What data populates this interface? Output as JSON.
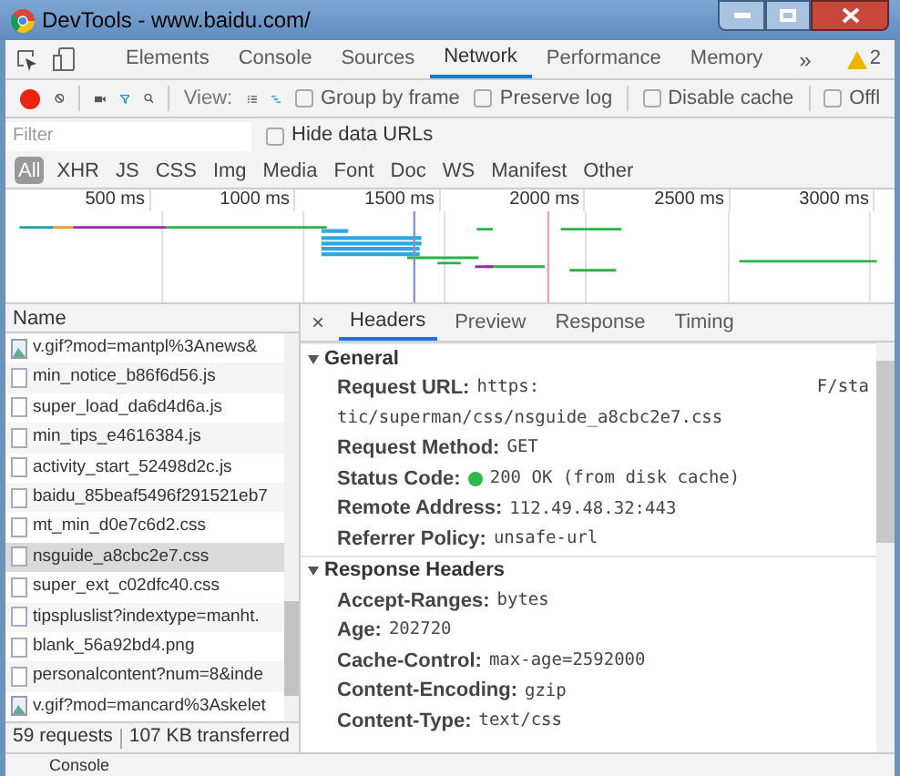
{
  "window": {
    "title": "DevTools - www.baidu.com/"
  },
  "panel_tabs": [
    {
      "label": "Elements",
      "selected": false
    },
    {
      "label": "Console",
      "selected": false
    },
    {
      "label": "Sources",
      "selected": false
    },
    {
      "label": "Network",
      "selected": true
    },
    {
      "label": "Performance",
      "selected": false
    },
    {
      "label": "Memory",
      "selected": false
    }
  ],
  "more_tabs": "»",
  "warnings": "2",
  "toolbar": {
    "recording": true,
    "view_label": "View:",
    "checkboxes": [
      {
        "label": "Group by frame",
        "checked": false
      },
      {
        "label": "Preserve log",
        "checked": false
      },
      {
        "label": "Disable cache",
        "checked": false
      },
      {
        "label": "Offl",
        "checked": false
      }
    ]
  },
  "filter": {
    "placeholder": "Filter",
    "hide_data_urls": {
      "label": "Hide data URLs",
      "checked": false
    }
  },
  "types": [
    {
      "label": "All",
      "selected": true
    },
    {
      "label": "XHR",
      "selected": false
    },
    {
      "label": "JS",
      "selected": false
    },
    {
      "label": "CSS",
      "selected": false
    },
    {
      "label": "Img",
      "selected": false
    },
    {
      "label": "Media",
      "selected": false
    },
    {
      "label": "Font",
      "selected": false
    },
    {
      "label": "Doc",
      "selected": false
    },
    {
      "label": "WS",
      "selected": false
    },
    {
      "label": "Manifest",
      "selected": false
    },
    {
      "label": "Other",
      "selected": false
    }
  ],
  "timeline": {
    "ticks": [
      "500 ms",
      "1000 ms",
      "1500 ms",
      "2000 ms",
      "2500 ms",
      "3000 ms"
    ]
  },
  "requests": {
    "column": "Name",
    "rows": [
      {
        "name": "v.gif?mod=mantpl%3Anews&",
        "kind": "image",
        "selected": false
      },
      {
        "name": "min_notice_b86f6d56.js",
        "kind": "file",
        "selected": false
      },
      {
        "name": "super_load_da6d4d6a.js",
        "kind": "file",
        "selected": false
      },
      {
        "name": "min_tips_e4616384.js",
        "kind": "file",
        "selected": false
      },
      {
        "name": "activity_start_52498d2c.js",
        "kind": "file",
        "selected": false
      },
      {
        "name": "baidu_85beaf5496f291521eb7",
        "kind": "file",
        "selected": false
      },
      {
        "name": "mt_min_d0e7c6d2.css",
        "kind": "file",
        "selected": false
      },
      {
        "name": "nsguide_a8cbc2e7.css",
        "kind": "file",
        "selected": true
      },
      {
        "name": "super_ext_c02dfc40.css",
        "kind": "file",
        "selected": false
      },
      {
        "name": "tipspluslist?indextype=manht.",
        "kind": "file",
        "selected": false
      },
      {
        "name": "blank_56a92bd4.png",
        "kind": "file",
        "selected": false
      },
      {
        "name": "personalcontent?num=8&inde",
        "kind": "file",
        "selected": false
      },
      {
        "name": "v.gif?mod=mancard%3Askelet",
        "kind": "image",
        "selected": false
      }
    ],
    "summary": "59 requests",
    "transferred": "107 KB transferred"
  },
  "detail": {
    "close": "×",
    "tabs": [
      {
        "label": "Headers",
        "selected": true
      },
      {
        "label": "Preview",
        "selected": false
      },
      {
        "label": "Response",
        "selected": false
      },
      {
        "label": "Timing",
        "selected": false
      }
    ],
    "sections": [
      {
        "title": "General",
        "expanded": true,
        "rows": [
          {
            "name": "Request URL:",
            "value": "https:",
            "value_end": "F/sta",
            "continuation": "tic/superman/css/nsguide_a8cbc2e7.css"
          },
          {
            "name": "Request Method:",
            "value": "GET"
          },
          {
            "name": "Status Code:",
            "value": "200 OK (from disk cache)",
            "color": "#2fb84a"
          },
          {
            "name": "Remote Address:",
            "value": "112.49.48.32:443"
          },
          {
            "name": "Referrer Policy:",
            "value": "unsafe-url"
          }
        ]
      },
      {
        "title": "Response Headers",
        "expanded": true,
        "rows": [
          {
            "name": "Accept-Ranges:",
            "value": "bytes"
          },
          {
            "name": "Age:",
            "value": "202720"
          },
          {
            "name": "Cache-Control:",
            "value": "max-age=2592000"
          },
          {
            "name": "Content-Encoding:",
            "value": "gzip"
          },
          {
            "name": "Content-Type:",
            "value": "text/css"
          }
        ]
      }
    ]
  },
  "drawer": {
    "tab": "Console"
  }
}
